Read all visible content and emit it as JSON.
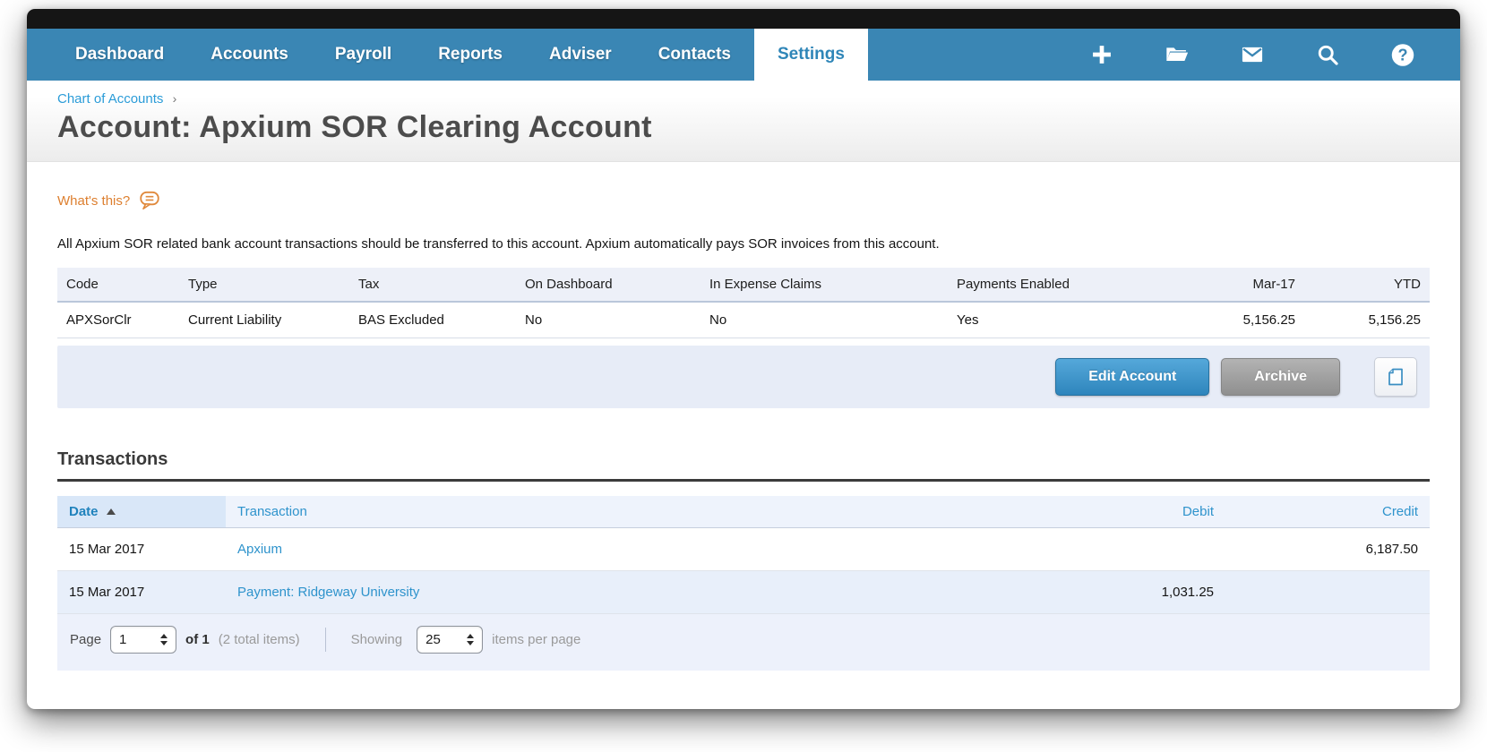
{
  "nav": {
    "tabs": [
      {
        "label": "Dashboard"
      },
      {
        "label": "Accounts"
      },
      {
        "label": "Payroll"
      },
      {
        "label": "Reports"
      },
      {
        "label": "Adviser"
      },
      {
        "label": "Contacts"
      },
      {
        "label": "Settings",
        "active": true
      }
    ],
    "icons": [
      "plus-icon",
      "folder-icon",
      "mail-icon",
      "search-icon",
      "help-icon"
    ],
    "help_glyph": "?"
  },
  "header": {
    "breadcrumb": "Chart of Accounts",
    "breadcrumb_sep": "›",
    "title": "Account: Apxium SOR Clearing Account"
  },
  "help_link": {
    "label": "What's this?"
  },
  "description": "All Apxium SOR related bank account transactions should be transferred to this account. Apxium automatically pays SOR invoices from this account.",
  "account_summary": {
    "columns": [
      "Code",
      "Type",
      "Tax",
      "On Dashboard",
      "In Expense Claims",
      "Payments Enabled",
      "Mar-17",
      "YTD"
    ],
    "row": {
      "code": "APXSorClr",
      "type": "Current Liability",
      "tax": "BAS Excluded",
      "on_dashboard": "No",
      "in_expense_claims": "No",
      "payments_enabled": "Yes",
      "mar_17": "5,156.25",
      "ytd": "5,156.25"
    },
    "actions": {
      "edit": "Edit Account",
      "archive": "Archive"
    }
  },
  "transactions": {
    "heading": "Transactions",
    "columns": {
      "date": "Date",
      "transaction": "Transaction",
      "debit": "Debit",
      "credit": "Credit"
    },
    "rows": [
      {
        "date": "15 Mar 2017",
        "transaction": "Apxium",
        "debit": "",
        "credit": "6,187.50"
      },
      {
        "date": "15 Mar 2017",
        "transaction": "Payment: Ridgeway University",
        "debit": "1,031.25",
        "credit": ""
      }
    ],
    "pagination": {
      "page_label": "Page",
      "page_value": "1",
      "of_label": "of 1",
      "total_label": "(2 total items)",
      "showing_label": "Showing",
      "per_page_value": "25",
      "per_page_label": "items per page"
    }
  },
  "colors": {
    "nav_blue": "#3a86b4",
    "link_blue": "#2e93cc",
    "orange_link": "#dd7f2f",
    "primary_button_blue": "#3e94c9",
    "archive_gray": "#9b9b9b",
    "header_row_blue": "#edf0f8",
    "alt_row_blue": "#e8effa"
  }
}
